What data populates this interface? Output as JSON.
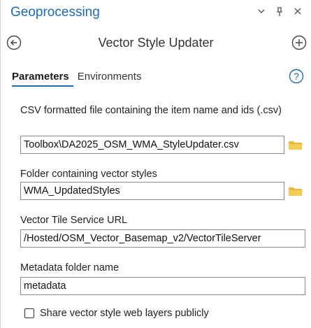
{
  "pane": {
    "title": "Geoprocessing",
    "menu_icon": "chevron-down-icon",
    "pin_icon": "pin-icon",
    "close_icon": "close-icon"
  },
  "tool": {
    "title": "Vector Style Updater",
    "back_icon": "back-arrow-icon",
    "add_icon": "add-icon"
  },
  "tabs": [
    {
      "label": "Parameters",
      "active": true
    },
    {
      "label": "Environments",
      "active": false
    }
  ],
  "help_icon": "help-icon",
  "params": {
    "csv": {
      "label": "CSV formatted file containing the item name and ids (.csv)",
      "value": "Toolbox\\DA2025_OSM_WMA_StyleUpdater.csv"
    },
    "styles_folder": {
      "label": "Folder containing vector styles",
      "value": "WMA_UpdatedStyles"
    },
    "vts_url": {
      "label": "Vector Tile Service URL",
      "value": "/Hosted/OSM_Vector_Basemap_v2/VectorTileServer"
    },
    "metadata": {
      "label": "Metadata folder name",
      "value": "metadata"
    },
    "share": {
      "label": "Share vector style web layers publicly",
      "checked": false
    }
  },
  "colors": {
    "accent": "#1f6ab1",
    "folder": "#e8b93c"
  }
}
